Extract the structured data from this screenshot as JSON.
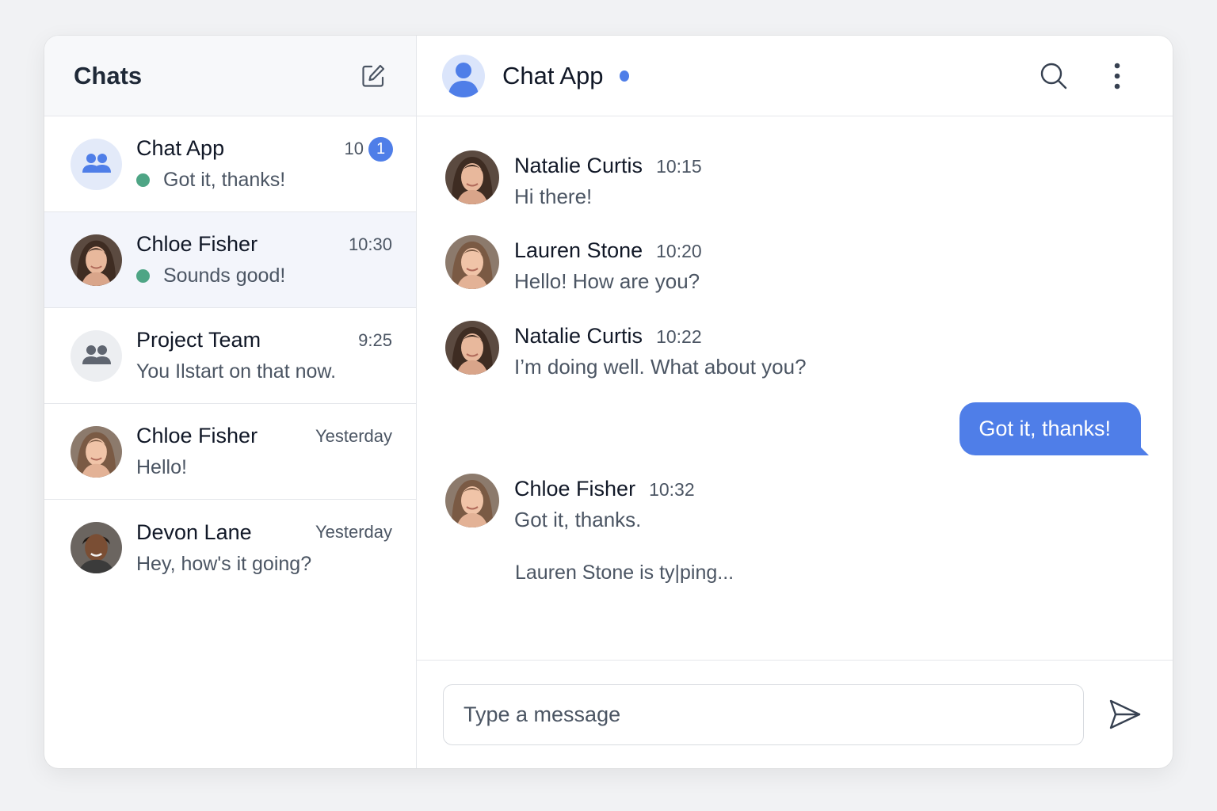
{
  "sidebar": {
    "title": "Chats",
    "chats": [
      {
        "name": "Chat App",
        "time": "10",
        "preview": "Got it, thanks!",
        "badge": "1",
        "online": true,
        "avatar": "group-icon"
      },
      {
        "name": "Chloe Fisher",
        "time": "10:30",
        "preview": "Sounds good!",
        "online": true,
        "avatar": "photo"
      },
      {
        "name": "Project Team",
        "time": "9:25",
        "preview": "You Ilstart on that now.",
        "online": false,
        "avatar": "group-icon"
      },
      {
        "name": "Chloe Fisher",
        "time": "Yesterday",
        "preview": "Hello!",
        "online": false,
        "avatar": "photo"
      },
      {
        "name": "Devon Lane",
        "time": "Yesterday",
        "preview": "Hey, how's it going?",
        "online": false,
        "avatar": "photo"
      }
    ]
  },
  "header": {
    "title": "Chat App"
  },
  "messages": [
    {
      "sender": "Natalie Curtis",
      "time": "10:15",
      "text": "Hi there!"
    },
    {
      "sender": "Lauren Stone",
      "time": "10:20",
      "text": "Hello! How are you?"
    },
    {
      "sender": "Natalie Curtis",
      "time": "10:22",
      "text": "I’m doing well.  What about you?"
    },
    {
      "sender": "Chloe Fisher",
      "time": "10:32",
      "text": "Got it, thanks."
    }
  ],
  "outgoing": {
    "text": "Got it, thanks!"
  },
  "typing": "Lauren Stone is ty|ping...",
  "composer": {
    "placeholder": "Type a message"
  },
  "colors": {
    "accent": "#4f7ee8",
    "online": "#4ea585",
    "active_row": "#f3f5fb"
  }
}
